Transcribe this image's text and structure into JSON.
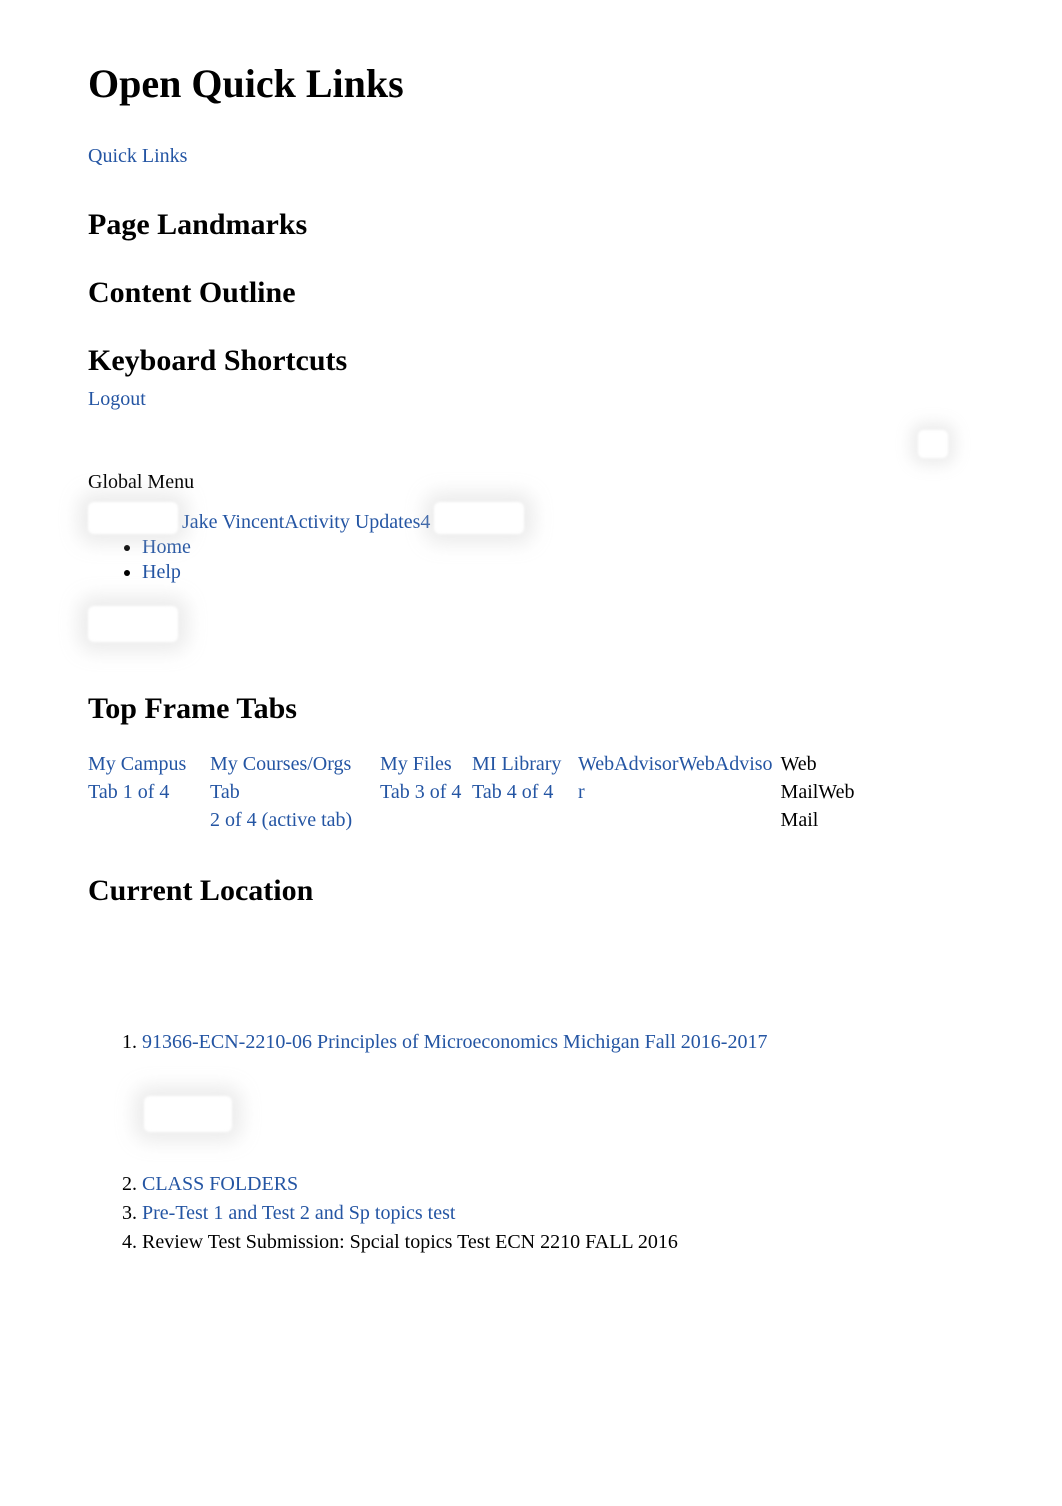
{
  "headings": {
    "main": "Open Quick Links",
    "page_landmarks": "Page Landmarks",
    "content_outline": "Content Outline",
    "keyboard_shortcuts": "Keyboard Shortcuts",
    "top_frame_tabs": "Top Frame Tabs",
    "current_location": "Current Location"
  },
  "links": {
    "quick_links": "Quick Links",
    "logout": "Logout"
  },
  "global_menu": {
    "label": "Global Menu",
    "user_name": "Jake Vincent",
    "activity_label": "Activity Updates",
    "activity_count": "4",
    "items": [
      {
        "label": "Home"
      },
      {
        "label": "Help"
      }
    ]
  },
  "tabs": [
    {
      "label": "My Campus",
      "sub": "Tab 1 of 4",
      "interactable": true
    },
    {
      "label": "My Courses/Orgs Tab",
      "sub": "2 of 4 (active tab)",
      "interactable": true
    },
    {
      "label": "My Files",
      "sub": "Tab 3 of 4",
      "interactable": true
    },
    {
      "label": "MI Library",
      "sub": "Tab 4 of 4",
      "interactable": true
    },
    {
      "label": "WebAdvisorWebAdviso",
      "sub": "r",
      "interactable": true
    },
    {
      "label": "Web MailWeb Mail",
      "sub": "",
      "interactable": false
    }
  ],
  "breadcrumbs": [
    {
      "label": "91366-ECN-2210-06 Principles of Microeconomics Michigan Fall 2016-2017",
      "link": true
    },
    {
      "label": "CLASS FOLDERS",
      "link": true
    },
    {
      "label": "Pre-Test 1 and Test 2 and Sp topics test",
      "link": true
    },
    {
      "label": "Review Test Submission: Spcial topics Test ECN 2210 FALL 2016",
      "link": false
    }
  ]
}
